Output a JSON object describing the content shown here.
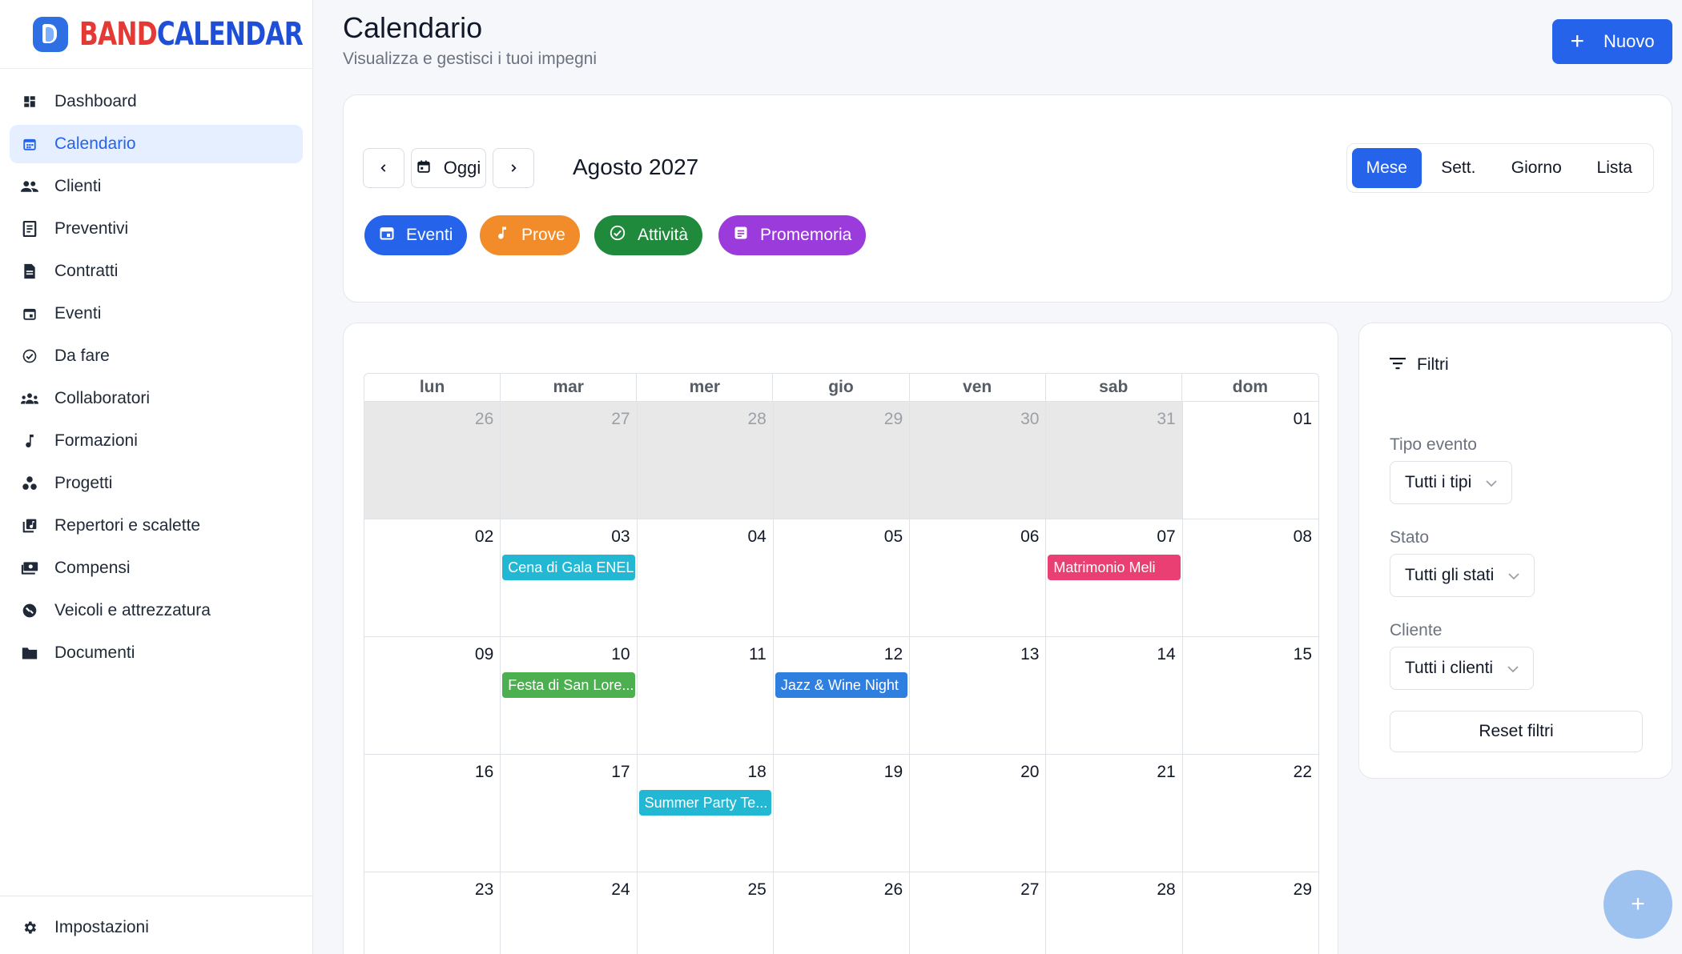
{
  "brand": {
    "part1": "BAND",
    "part2": "CALENDAR"
  },
  "sidebar": {
    "items": [
      {
        "label": "Dashboard",
        "icon": "dashboard-icon"
      },
      {
        "label": "Calendario",
        "icon": "calendar-icon",
        "active": true
      },
      {
        "label": "Clienti",
        "icon": "people-icon"
      },
      {
        "label": "Preventivi",
        "icon": "receipt-icon"
      },
      {
        "label": "Contratti",
        "icon": "document-icon"
      },
      {
        "label": "Eventi",
        "icon": "event-icon"
      },
      {
        "label": "Da fare",
        "icon": "check-circle-icon"
      },
      {
        "label": "Collaboratori",
        "icon": "group-icon"
      },
      {
        "label": "Formazioni",
        "icon": "music-note-icon"
      },
      {
        "label": "Progetti",
        "icon": "workspaces-icon"
      },
      {
        "label": "Repertori e scalette",
        "icon": "library-music-icon"
      },
      {
        "label": "Compensi",
        "icon": "payments-icon"
      },
      {
        "label": "Veicoli e attrezzatura",
        "icon": "vehicle-icon"
      },
      {
        "label": "Documenti",
        "icon": "folder-icon"
      }
    ],
    "settings_label": "Impostazioni"
  },
  "header": {
    "title": "Calendario",
    "subtitle": "Visualizza e gestisci i tuoi impegni",
    "new_button": "Nuovo"
  },
  "toolbar": {
    "today_label": "Oggi",
    "month_label": "Agosto 2027",
    "views": [
      "Mese",
      "Sett.",
      "Giorno",
      "Lista"
    ],
    "active_view": "Mese",
    "categories": [
      {
        "label": "Eventi",
        "color": "#2563eb",
        "icon": "event-icon"
      },
      {
        "label": "Prove",
        "color": "#f28c2b",
        "icon": "music-note-icon"
      },
      {
        "label": "Attività",
        "color": "#1f8a3b",
        "icon": "check-circle-icon"
      },
      {
        "label": "Promemoria",
        "color": "#9b3bdb",
        "icon": "note-icon"
      }
    ]
  },
  "calendar": {
    "weekdays": [
      "lun",
      "mar",
      "mer",
      "gio",
      "ven",
      "sab",
      "dom"
    ],
    "weeks": [
      [
        {
          "d": "26",
          "o": true
        },
        {
          "d": "27",
          "o": true
        },
        {
          "d": "28",
          "o": true
        },
        {
          "d": "29",
          "o": true
        },
        {
          "d": "30",
          "o": true
        },
        {
          "d": "31",
          "o": true
        },
        {
          "d": "01"
        }
      ],
      [
        {
          "d": "02"
        },
        {
          "d": "03",
          "e": "Cena di Gala ENEL",
          "c": "#22b8d4"
        },
        {
          "d": "04"
        },
        {
          "d": "05"
        },
        {
          "d": "06"
        },
        {
          "d": "07",
          "e": "Matrimonio Meli",
          "c": "#ea3f72"
        },
        {
          "d": "08"
        }
      ],
      [
        {
          "d": "09"
        },
        {
          "d": "10",
          "e": "Festa di San Lore...",
          "c": "#4caf50"
        },
        {
          "d": "11"
        },
        {
          "d": "12",
          "e": "Jazz & Wine Night",
          "c": "#2f7fe0"
        },
        {
          "d": "13"
        },
        {
          "d": "14"
        },
        {
          "d": "15"
        }
      ],
      [
        {
          "d": "16"
        },
        {
          "d": "17"
        },
        {
          "d": "18",
          "e": "Summer Party Te...",
          "c": "#22b8d4"
        },
        {
          "d": "19"
        },
        {
          "d": "20"
        },
        {
          "d": "21"
        },
        {
          "d": "22"
        }
      ],
      [
        {
          "d": "23"
        },
        {
          "d": "24"
        },
        {
          "d": "25"
        },
        {
          "d": "26"
        },
        {
          "d": "27"
        },
        {
          "d": "28"
        },
        {
          "d": "29"
        }
      ]
    ]
  },
  "filters": {
    "title": "Filtri",
    "event_type_label": "Tipo evento",
    "event_type_value": "Tutti i tipi",
    "status_label": "Stato",
    "status_value": "Tutti gli stati",
    "client_label": "Cliente",
    "client_value": "Tutti i clienti",
    "reset_label": "Reset filtri"
  },
  "fab": {
    "label": "+"
  }
}
